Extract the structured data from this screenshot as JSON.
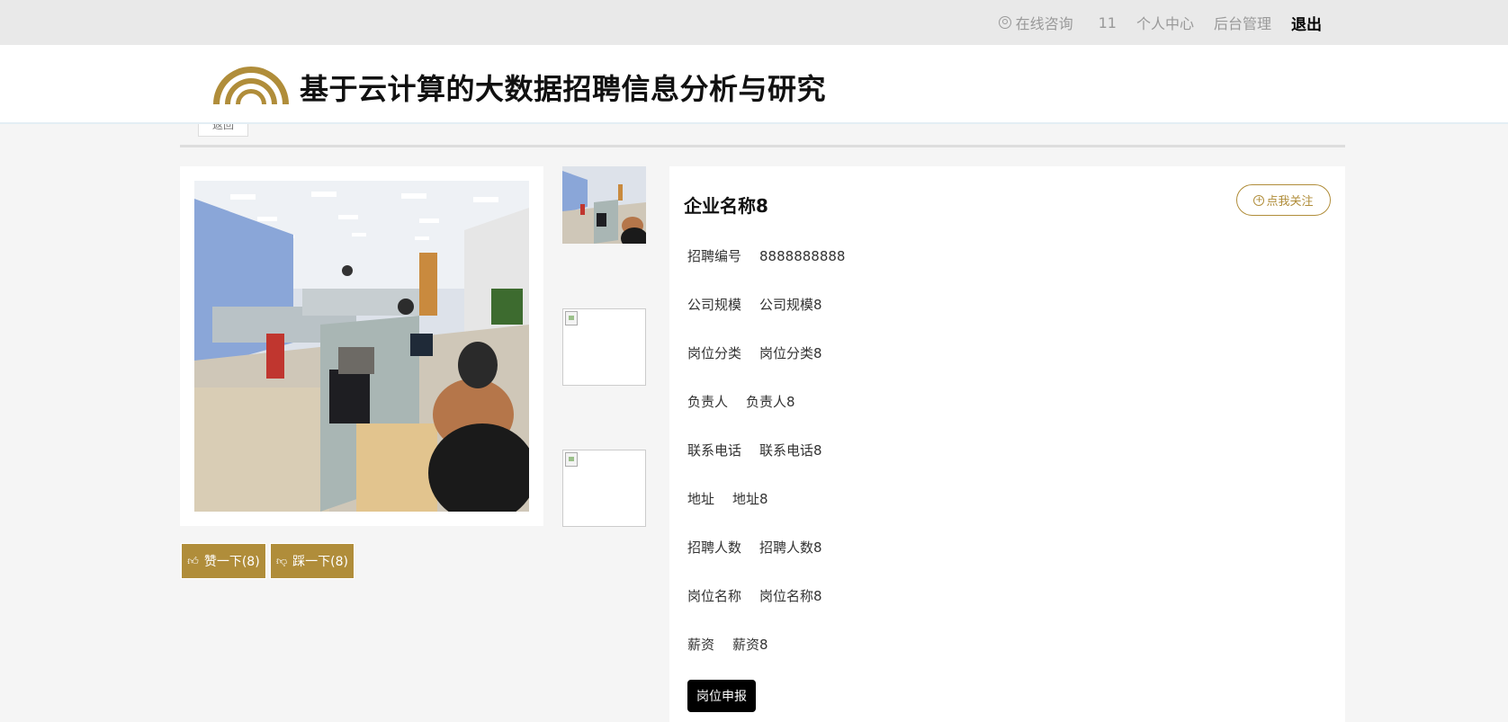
{
  "topbar": {
    "consult": "在线咨询",
    "user": "11",
    "personal_center": "个人中心",
    "admin": "后台管理",
    "logout": "退出"
  },
  "header": {
    "title": "基于云计算的大数据招聘信息分析与研究"
  },
  "back_label": "返回",
  "vote": {
    "up_label": "赞一下(8)",
    "down_label": "踩一下(8)"
  },
  "company": {
    "name": "企业名称8",
    "follow_label": "点我关注"
  },
  "fields": [
    {
      "label": "招聘编号",
      "value": "8888888888"
    },
    {
      "label": "公司规模",
      "value": "公司规模8"
    },
    {
      "label": "岗位分类",
      "value": "岗位分类8"
    },
    {
      "label": "负责人",
      "value": "负责人8"
    },
    {
      "label": "联系电话",
      "value": "联系电话8"
    },
    {
      "label": "地址",
      "value": "地址8"
    },
    {
      "label": "招聘人数",
      "value": "招聘人数8"
    },
    {
      "label": "岗位名称",
      "value": "岗位名称8"
    },
    {
      "label": "薪资",
      "value": "薪资8"
    }
  ],
  "apply_label": "岗位申报",
  "colors": {
    "accent": "#b08d3a",
    "topbar_bg": "#e9e9e9",
    "page_bg": "#f5f5f5"
  }
}
